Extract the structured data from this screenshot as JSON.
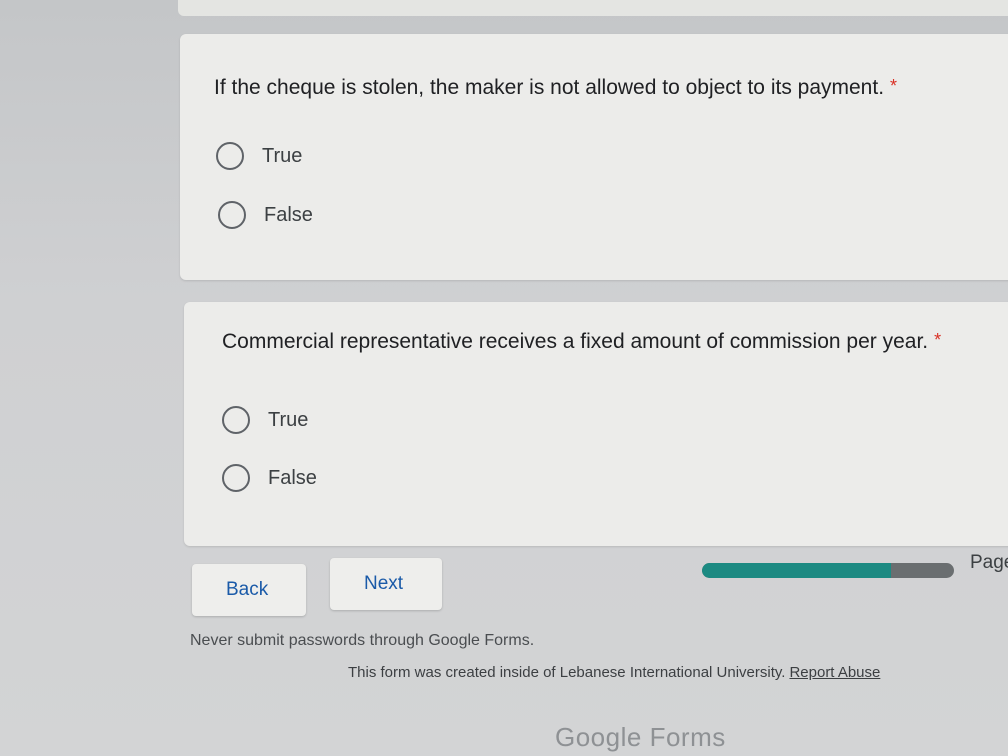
{
  "questions": [
    {
      "text": "If the cheque is stolen, the maker is not allowed to object to its payment.",
      "required_mark": "*",
      "options": [
        "True",
        "False"
      ]
    },
    {
      "text": "Commercial representative receives a fixed amount of commission per year.",
      "required_mark": "*",
      "options": [
        "True",
        "False"
      ]
    }
  ],
  "navigation": {
    "back_label": "Back",
    "next_label": "Next"
  },
  "progress": {
    "label": "Page",
    "fraction": 0.75,
    "fill_color": "#1c8a82",
    "track_color": "#6a6e70"
  },
  "footer": {
    "warning": "Never submit passwords through Google Forms.",
    "created_text": "This form was created inside of Lebanese International University.",
    "report_link": "Report Abuse",
    "brand": "Google Forms"
  }
}
